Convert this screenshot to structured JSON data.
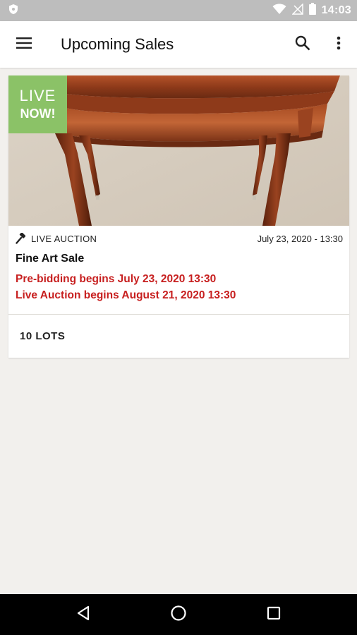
{
  "status_bar": {
    "time": "14:03",
    "left_icon": "android-shield-icon",
    "icons": [
      "wifi-icon",
      "no-signal-icon",
      "battery-icon"
    ]
  },
  "app_bar": {
    "title": "Upcoming Sales",
    "menu_icon": "hamburger-menu-icon",
    "search_icon": "search-icon",
    "more_icon": "more-vert-icon"
  },
  "sales": [
    {
      "badge": {
        "line1": "LIVE",
        "line2": "NOW!"
      },
      "auction_type": "LIVE AUCTION",
      "date": "July 23, 2020 - 13:30",
      "title": "Fine Art Sale",
      "pre_bidding": "Pre-bidding begins July 23, 2020  13:30",
      "live_auction": "Live Auction begins August 21, 2020  13:30",
      "lots": "10 LOTS"
    }
  ],
  "nav_bar": {
    "back": "back-triangle-icon",
    "home": "home-circle-icon",
    "recents": "recents-square-icon"
  },
  "colors": {
    "accent_red": "#c71f1f",
    "badge_green": "#8bc267",
    "background": "#f2f0ed"
  }
}
